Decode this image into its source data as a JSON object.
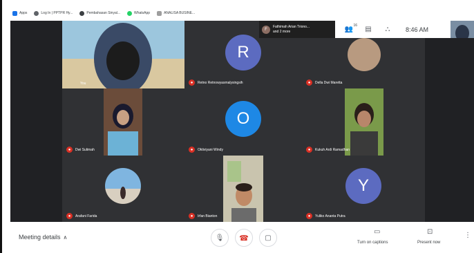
{
  "bookmarks": [
    {
      "label": "Apps",
      "color": "#1a73e8"
    },
    {
      "label": "Log In | PPTPR Hy...",
      "color": "#5f6368"
    },
    {
      "label": "Pembahasan Sinyal...",
      "color": "#3c4043"
    },
    {
      "label": "WhatsApp",
      "color": "#25d366"
    },
    {
      "label": "ANALISA BUSINE...",
      "color": "#9e9e9e"
    }
  ],
  "owner": {
    "initial": "F",
    "line1": "Fathimah Arian Triono...",
    "line2": "and 2 more"
  },
  "topbar": {
    "people_count": "16",
    "time": "8:46 AM"
  },
  "participants": [
    {
      "name": "You",
      "kind": "video"
    },
    {
      "name": "Retno Retnowyasmalysingsih",
      "kind": "avatar",
      "initial": "R",
      "color": "#5c6bc0"
    },
    {
      "name": "Della Dwi Maretta",
      "kind": "photo"
    },
    {
      "name": "Dwi Sulimah",
      "kind": "video"
    },
    {
      "name": "Oktiviyani Windy",
      "kind": "avatar",
      "initial": "O",
      "color": "#1e88e5"
    },
    {
      "name": "Kukuh Ardi Ramadhan",
      "kind": "video"
    },
    {
      "name": "Arafani Farida",
      "kind": "photo"
    },
    {
      "name": "Irfan Bianton",
      "kind": "video"
    },
    {
      "name": "Yuliko Ananta Putra",
      "kind": "avatar",
      "initial": "Y",
      "color": "#5c6bc0"
    }
  ],
  "bottom": {
    "meeting_details": "Meeting details",
    "captions_label": "Turn on captions",
    "present_label": "Present now"
  },
  "colors": {
    "mute": "#d93025",
    "end_call": "#d93025",
    "stage": "#202124"
  }
}
